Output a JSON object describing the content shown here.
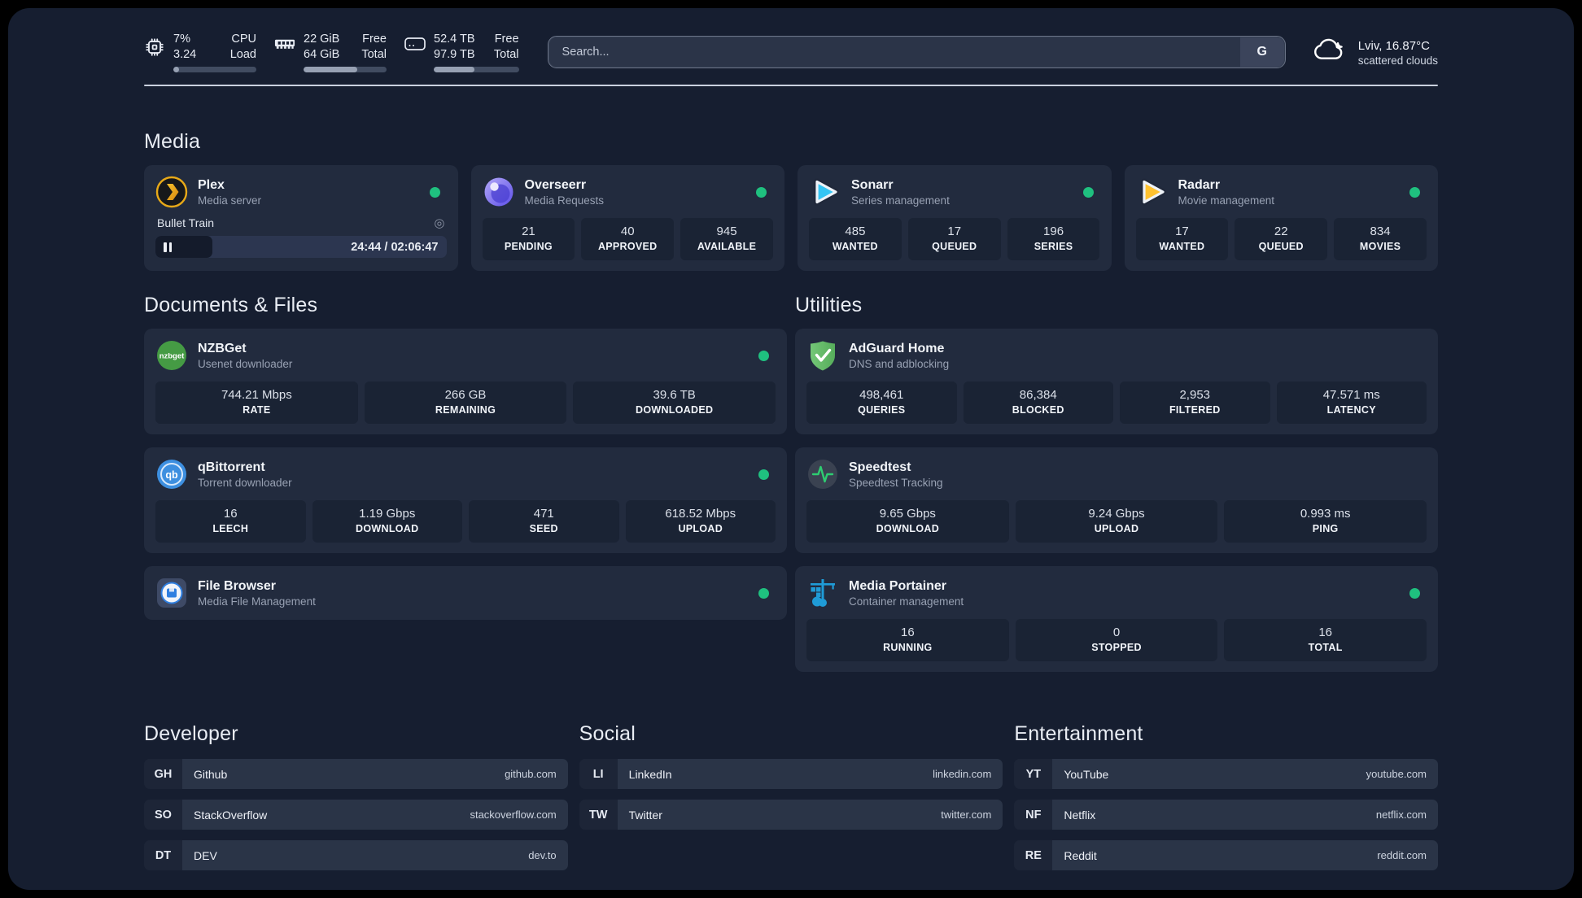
{
  "header": {
    "stats": [
      {
        "icon": "cpu-icon",
        "value_top": "7%",
        "value_bottom": "3.24",
        "label_top": "CPU",
        "label_bottom": "Load",
        "progress": 7
      },
      {
        "icon": "memory-icon",
        "value_top": "22 GiB",
        "value_bottom": "64 GiB",
        "label_top": "Free",
        "label_bottom": "Total",
        "progress": 65
      },
      {
        "icon": "disk-icon",
        "value_top": "52.4 TB",
        "value_bottom": "97.9 TB",
        "label_top": "Free",
        "label_bottom": "Total",
        "progress": 48
      }
    ],
    "search": {
      "placeholder": "Search...",
      "engine": "G",
      "engine_icon": "google-icon"
    },
    "weather": {
      "icon": "cloud-icon",
      "location": "Lviv, 16.87°C",
      "condition": "scattered clouds"
    }
  },
  "sections": {
    "media": {
      "title": "Media"
    },
    "documents": {
      "title": "Documents & Files"
    },
    "utilities": {
      "title": "Utilities"
    },
    "developer": {
      "title": "Developer"
    },
    "social": {
      "title": "Social"
    },
    "entertainment": {
      "title": "Entertainment"
    }
  },
  "services": {
    "plex": {
      "icon": "plex-icon",
      "name": "Plex",
      "subtitle": "Media server",
      "online": true,
      "now_playing": "Bullet Train",
      "session_icon": "session-type-icon",
      "pause_icon": "pause-icon",
      "time": "24:44 / 02:06:47",
      "progress": 19.6
    },
    "overseerr": {
      "icon": "overseerr-icon",
      "name": "Overseerr",
      "subtitle": "Media Requests",
      "online": true,
      "stats": [
        {
          "value": "21",
          "label": "PENDING"
        },
        {
          "value": "40",
          "label": "APPROVED"
        },
        {
          "value": "945",
          "label": "AVAILABLE"
        }
      ]
    },
    "sonarr": {
      "icon": "sonarr-icon",
      "name": "Sonarr",
      "subtitle": "Series management",
      "online": true,
      "stats": [
        {
          "value": "485",
          "label": "WANTED"
        },
        {
          "value": "17",
          "label": "QUEUED"
        },
        {
          "value": "196",
          "label": "SERIES"
        }
      ]
    },
    "radarr": {
      "icon": "radarr-icon",
      "name": "Radarr",
      "subtitle": "Movie management",
      "online": true,
      "stats": [
        {
          "value": "17",
          "label": "WANTED"
        },
        {
          "value": "22",
          "label": "QUEUED"
        },
        {
          "value": "834",
          "label": "MOVIES"
        }
      ]
    },
    "nzbget": {
      "icon": "nzbget-icon",
      "name": "NZBGet",
      "subtitle": "Usenet downloader",
      "online": true,
      "stats": [
        {
          "value": "744.21 Mbps",
          "label": "RATE"
        },
        {
          "value": "266 GB",
          "label": "REMAINING"
        },
        {
          "value": "39.6 TB",
          "label": "DOWNLOADED"
        }
      ]
    },
    "qbittorrent": {
      "icon": "qbittorrent-icon",
      "name": "qBittorrent",
      "subtitle": "Torrent downloader",
      "online": true,
      "stats": [
        {
          "value": "16",
          "label": "LEECH"
        },
        {
          "value": "1.19 Gbps",
          "label": "DOWNLOAD"
        },
        {
          "value": "471",
          "label": "SEED"
        },
        {
          "value": "618.52 Mbps",
          "label": "UPLOAD"
        }
      ]
    },
    "filebrowser": {
      "icon": "filebrowser-icon",
      "name": "File Browser",
      "subtitle": "Media File Management",
      "online": true
    },
    "adguard": {
      "icon": "adguard-icon",
      "name": "AdGuard Home",
      "subtitle": "DNS and adblocking",
      "stats": [
        {
          "value": "498,461",
          "label": "QUERIES"
        },
        {
          "value": "86,384",
          "label": "BLOCKED"
        },
        {
          "value": "2,953",
          "label": "FILTERED"
        },
        {
          "value": "47.571 ms",
          "label": "LATENCY"
        }
      ]
    },
    "speedtest": {
      "icon": "speedtest-icon",
      "name": "Speedtest",
      "subtitle": "Speedtest Tracking",
      "stats": [
        {
          "value": "9.65 Gbps",
          "label": "DOWNLOAD"
        },
        {
          "value": "9.24 Gbps",
          "label": "UPLOAD"
        },
        {
          "value": "0.993 ms",
          "label": "PING"
        }
      ]
    },
    "portainer": {
      "icon": "portainer-icon",
      "name": "Media Portainer",
      "subtitle": "Container management",
      "online": true,
      "stats": [
        {
          "value": "16",
          "label": "RUNNING"
        },
        {
          "value": "0",
          "label": "STOPPED"
        },
        {
          "value": "16",
          "label": "TOTAL"
        }
      ]
    }
  },
  "bookmarks": {
    "developer": [
      {
        "abbr": "GH",
        "name": "Github",
        "url": "github.com"
      },
      {
        "abbr": "SO",
        "name": "StackOverflow",
        "url": "stackoverflow.com"
      },
      {
        "abbr": "DT",
        "name": "DEV",
        "url": "dev.to"
      }
    ],
    "social": [
      {
        "abbr": "LI",
        "name": "LinkedIn",
        "url": "linkedin.com"
      },
      {
        "abbr": "TW",
        "name": "Twitter",
        "url": "twitter.com"
      }
    ],
    "entertainment": [
      {
        "abbr": "YT",
        "name": "YouTube",
        "url": "youtube.com"
      },
      {
        "abbr": "NF",
        "name": "Netflix",
        "url": "netflix.com"
      },
      {
        "abbr": "RE",
        "name": "Reddit",
        "url": "reddit.com"
      }
    ]
  },
  "colors": {
    "page_bg": "#161e30",
    "card_bg": "#222b3e",
    "stat_bg": "#1a2334",
    "status_online": "#1fc07f",
    "plex_orange": "#ebaf1a",
    "sonarr_blue": "#35c5f4",
    "radarr_yellow": "#ffc230",
    "adguard_green": "#67bd6a",
    "nzbget_green": "#3f9b3f",
    "qbittorrent_blue": "#3d8fe0",
    "portainer_blue": "#1f9bd7",
    "speedtest_green": "#2ecc71",
    "overseerr_purple": "#6c5ce7"
  }
}
